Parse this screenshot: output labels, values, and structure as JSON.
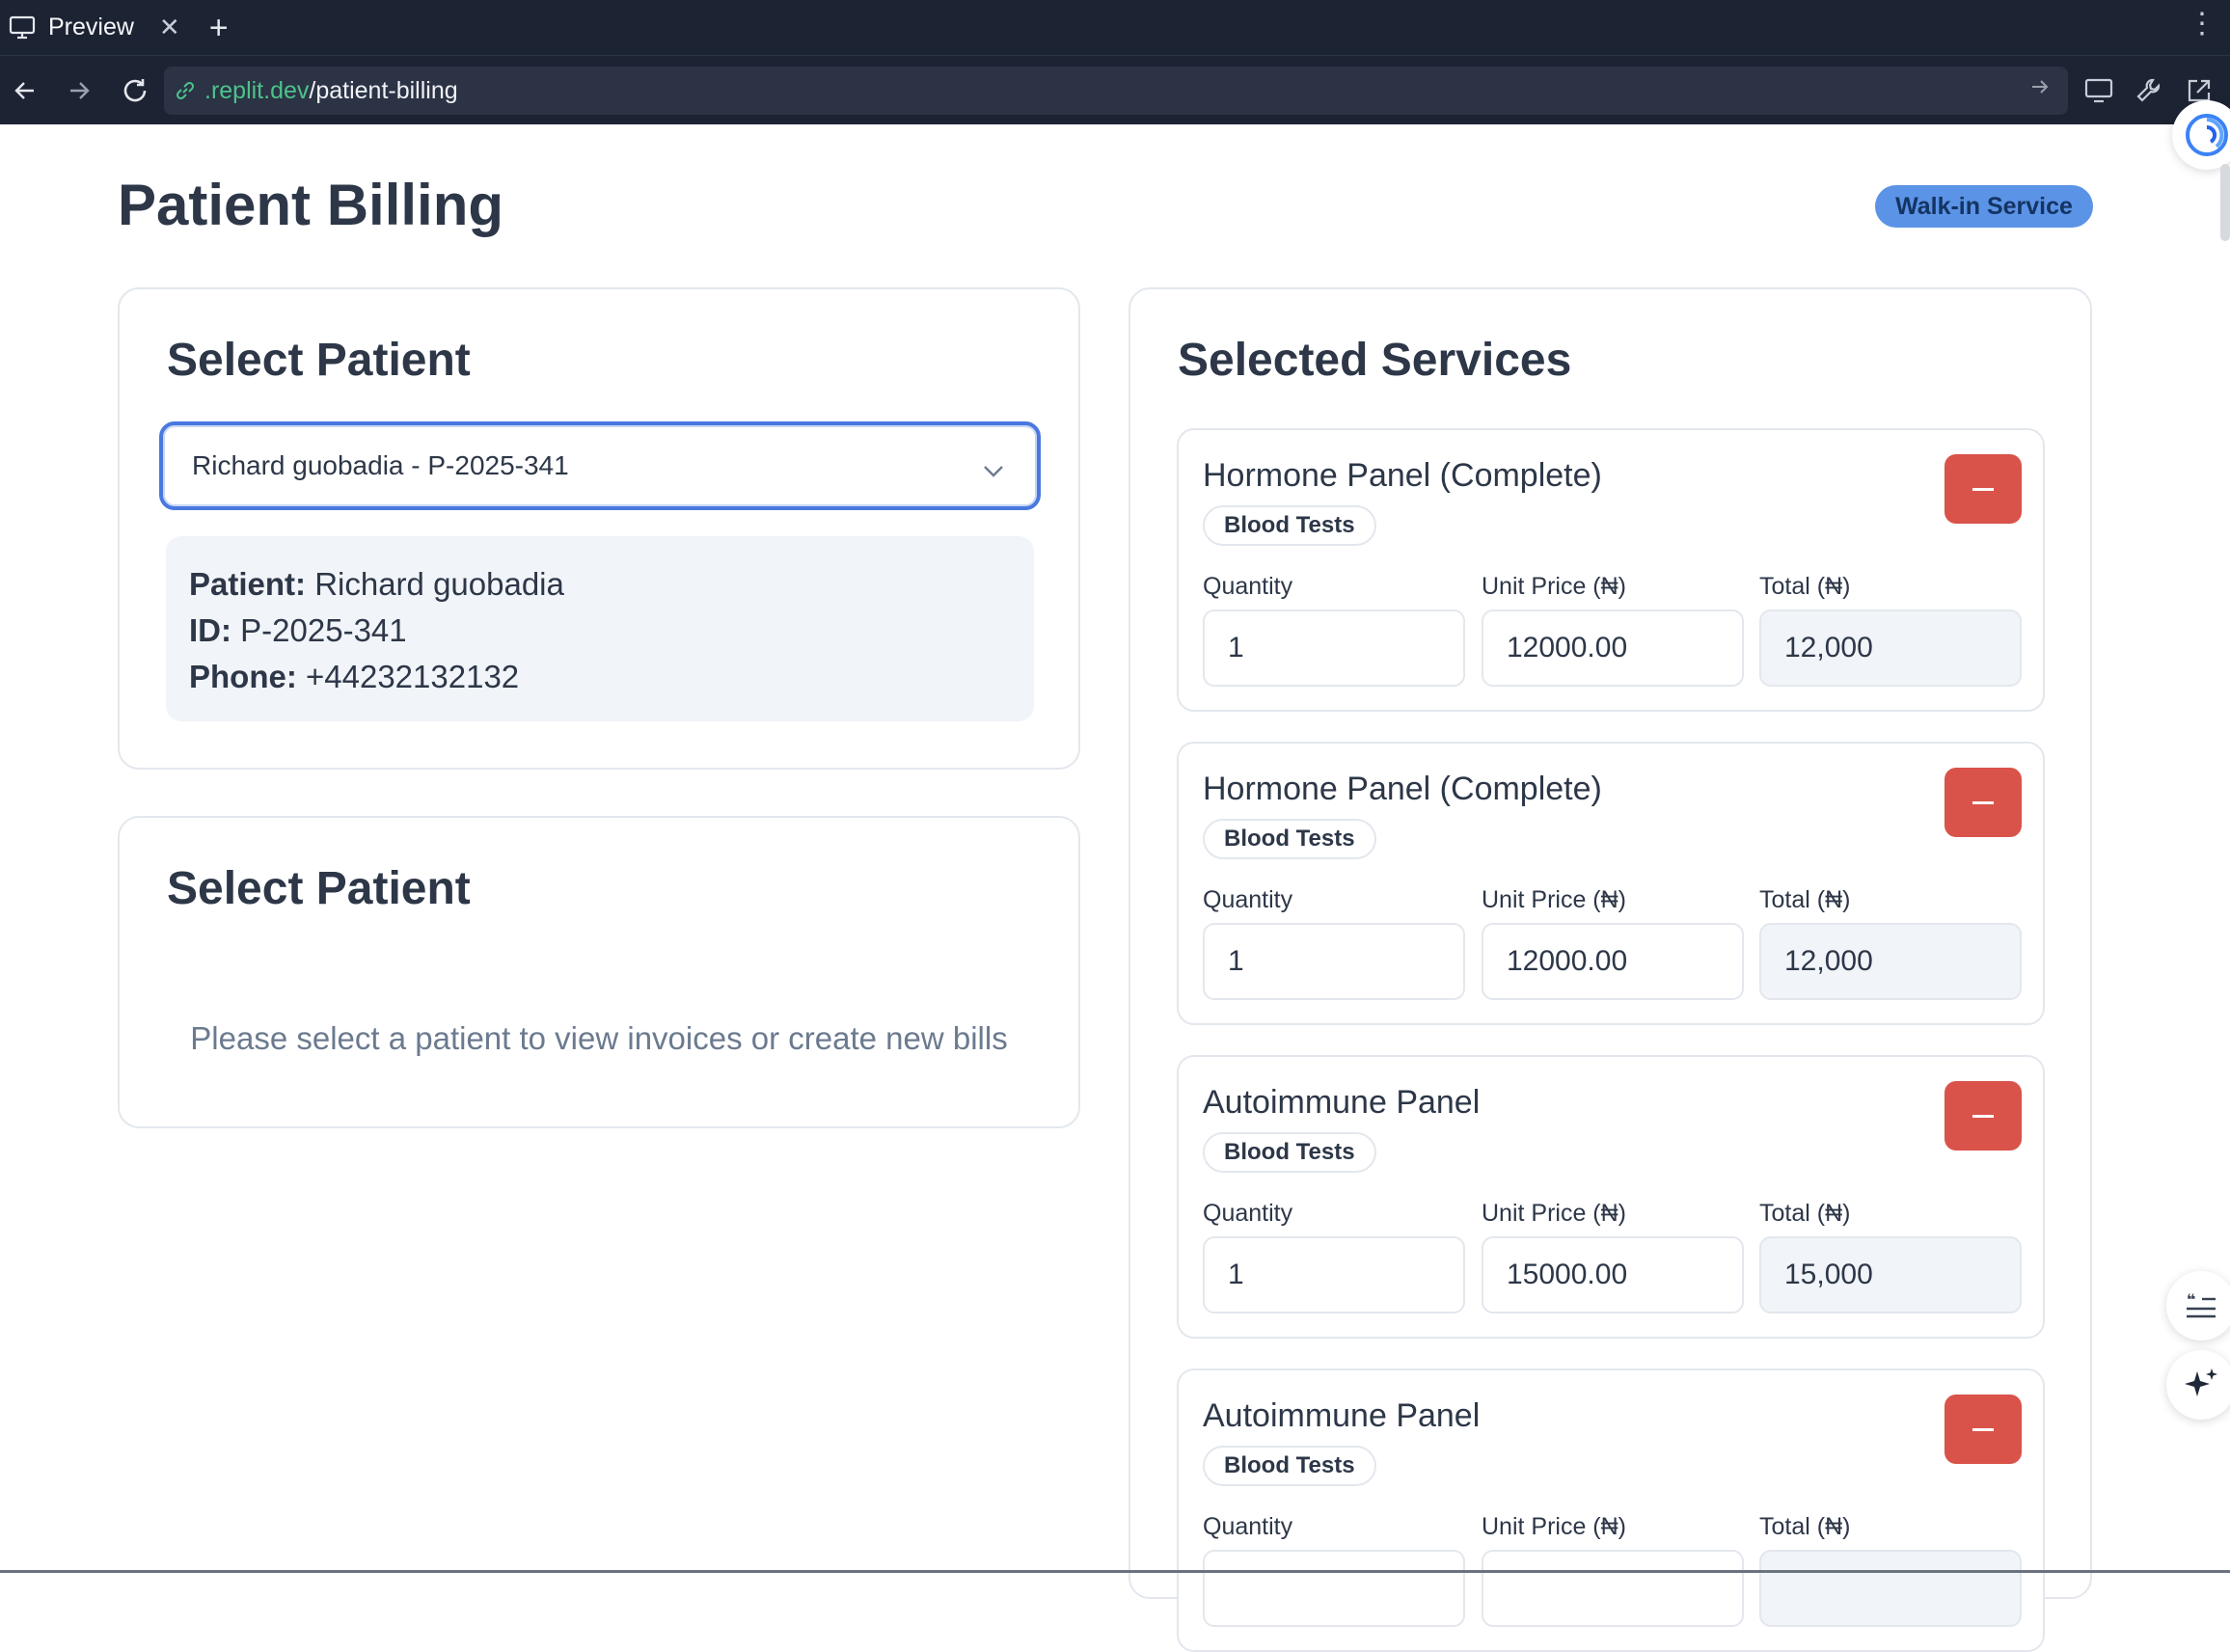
{
  "browser": {
    "tab_title": "Preview",
    "url_host": ".replit.dev",
    "url_path": "/patient-billing"
  },
  "page": {
    "title": "Patient Billing",
    "badge": "Walk-in Service"
  },
  "patient_card": {
    "heading": "Select Patient",
    "selected": "Richard guobadia - P-2025-341",
    "info": {
      "patient_label": "Patient:",
      "patient_value": "Richard guobadia",
      "id_label": "ID:",
      "id_value": "P-2025-341",
      "phone_label": "Phone:",
      "phone_value": "+44232132132"
    }
  },
  "invoice_card": {
    "heading": "Select Patient",
    "empty_message": "Please select a patient to view invoices or create new bills"
  },
  "services": {
    "heading": "Selected Services",
    "labels": {
      "quantity": "Quantity",
      "unit_price": "Unit Price (₦)",
      "total": "Total (₦)"
    },
    "items": [
      {
        "name": "Hormone Panel (Complete)",
        "category": "Blood Tests",
        "quantity": "1",
        "unit_price": "12000.00",
        "total": "12,000"
      },
      {
        "name": "Hormone Panel (Complete)",
        "category": "Blood Tests",
        "quantity": "1",
        "unit_price": "12000.00",
        "total": "12,000"
      },
      {
        "name": "Autoimmune Panel",
        "category": "Blood Tests",
        "quantity": "1",
        "unit_price": "15000.00",
        "total": "15,000"
      },
      {
        "name": "Autoimmune Panel",
        "category": "Blood Tests",
        "quantity": "",
        "unit_price": "",
        "total": ""
      }
    ]
  },
  "colors": {
    "accent": "#4a78e0",
    "badge": "#5b93e6",
    "danger": "#d9534a",
    "chrome": "#1c2333"
  }
}
